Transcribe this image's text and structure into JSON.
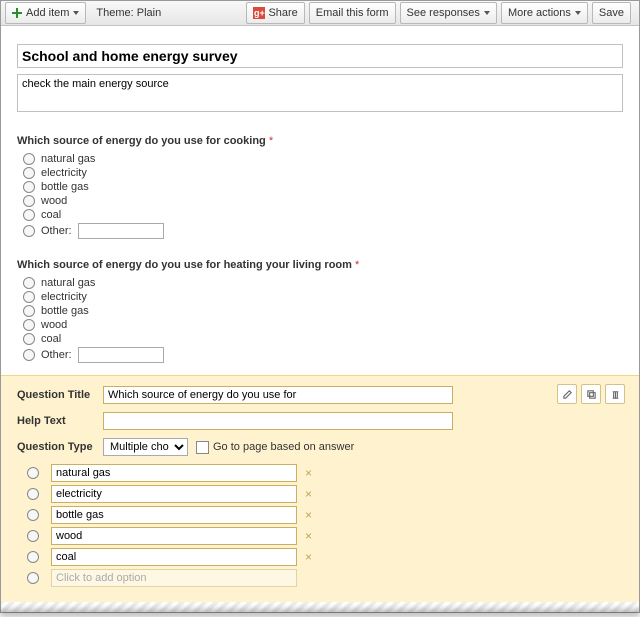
{
  "toolbar": {
    "add_item": "Add item",
    "theme_label": "Theme:",
    "theme_value": "Plain",
    "share": "Share",
    "email": "Email this form",
    "responses": "See responses",
    "more_actions": "More actions",
    "save": "Save"
  },
  "form": {
    "title": "School and home energy survey",
    "description": "check the main energy source"
  },
  "questions": [
    {
      "title": "Which source of energy do you use for cooking",
      "required": true,
      "options": [
        "natural gas",
        "electricity",
        "bottle gas",
        "wood",
        "coal"
      ],
      "other_label": "Other:"
    },
    {
      "title": "Which source of energy do you use for heating your living room",
      "required": true,
      "options": [
        "natural gas",
        "electricity",
        "bottle gas",
        "wood",
        "coal"
      ],
      "other_label": "Other:"
    }
  ],
  "editor": {
    "labels": {
      "question_title": "Question Title",
      "help_text": "Help Text",
      "question_type": "Question Type"
    },
    "question_title_value": "Which source of energy do you use for ",
    "help_text_value": "",
    "question_type_value": "Multiple choice",
    "go_to_page_label": "Go to page based on answer",
    "options": [
      "natural gas",
      "electricity",
      "bottle gas",
      "wood",
      "coal"
    ],
    "add_option_placeholder": "Click to add option"
  }
}
